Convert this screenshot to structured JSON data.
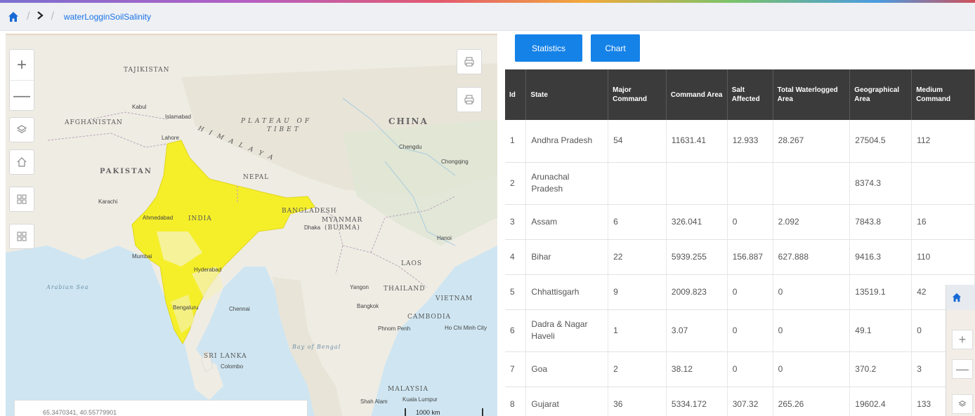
{
  "breadcrumb": {
    "home_icon": "home-icon",
    "arrow_icon": "chevron-right-icon",
    "title": "waterLogginSoilSalinity"
  },
  "map": {
    "labels": {
      "china": "CHINA",
      "plateau": "PLATEAU OF",
      "tibet": "TIBET",
      "himalaya": "H I M A L A Y A",
      "tajikistan": "TAJIKISTAN",
      "afghanistan": "AFGHANISTAN",
      "pakistan": "PAKISTAN",
      "nepal": "NEPAL",
      "india": "INDIA",
      "bangladesh": "BANGLADESH",
      "myanmar": "MYANMAR",
      "myanmar_sub": "(BURMA)",
      "thailand": "THAILAND",
      "vietnam": "VIETNAM",
      "cambodia": "CAMBODIA",
      "laos": "LAOS",
      "srilanka": "SRI LANKA",
      "malaysia": "MALAYSIA",
      "kabul": "Kabul",
      "islamabad": "Islamabad",
      "lahore": "Lahore",
      "karachi": "Karachi",
      "ahmedabad": "Ahmedabad",
      "mumbai": "Mumbai",
      "hyderabad": "Hyderabad",
      "bengaluru": "Bengaluru",
      "chennai": "Chennai",
      "colombo": "Colombo",
      "dhaka": "Dhaka",
      "yangon": "Yangon",
      "bangkok": "Bangkok",
      "hanoi": "Hanoi",
      "phnom_penh": "Phnom Penh",
      "ho_chi_minh": "Ho Chi Minh City",
      "chengdu": "Chengdu",
      "chongqing": "Chongqing",
      "shah_alam": "Shah Alam",
      "kuala_lumpur": "Kuala Lumpur",
      "arabian_sea": "Arabian Sea",
      "bay_of_bengal": "Bay of Bengal"
    },
    "scale": "1000 km",
    "coordinates": "65.3470341, 40.55779901"
  },
  "controls": {
    "zoom_in": "+",
    "zoom_out": "—",
    "print_icon": "printer-icon"
  },
  "tabs": {
    "statistics": "Statistics",
    "chart": "Chart"
  },
  "table": {
    "headers": [
      "Id",
      "State",
      "Major Command",
      "Command Area",
      "Salt Affected",
      "Total Waterlogged Area",
      "Geographical Area",
      "Medium Command"
    ],
    "rows": [
      [
        "1",
        "Andhra Pradesh",
        "54",
        "11631.41",
        "12.933",
        "28.267",
        "27504.5",
        "112"
      ],
      [
        "2",
        "Arunachal Pradesh",
        "",
        "",
        "",
        "",
        "8374.3",
        ""
      ],
      [
        "3",
        "Assam",
        "6",
        "326.041",
        "0",
        "2.092",
        "7843.8",
        "16"
      ],
      [
        "4",
        "Bihar",
        "22",
        "5939.255",
        "156.887",
        "627.888",
        "9416.3",
        "110"
      ],
      [
        "5",
        "Chhattisgarh",
        "9",
        "2009.823",
        "0",
        "0",
        "13519.1",
        "42"
      ],
      [
        "6",
        "Dadra & Nagar Haveli",
        "1",
        "3.07",
        "0",
        "0",
        "49.1",
        "0"
      ],
      [
        "7",
        "Goa",
        "2",
        "38.12",
        "0",
        "0",
        "370.2",
        "3"
      ],
      [
        "8",
        "Gujarat",
        "36",
        "5334.172",
        "307.32",
        "265.26",
        "19602.4",
        "133"
      ]
    ]
  },
  "mini_widget": {
    "zoom_in": "+",
    "zoom_out": "—"
  },
  "colors": {
    "accent": "#1582e8",
    "header_bg": "#3b3b3b",
    "highlight_region": "#f5ef2a"
  }
}
